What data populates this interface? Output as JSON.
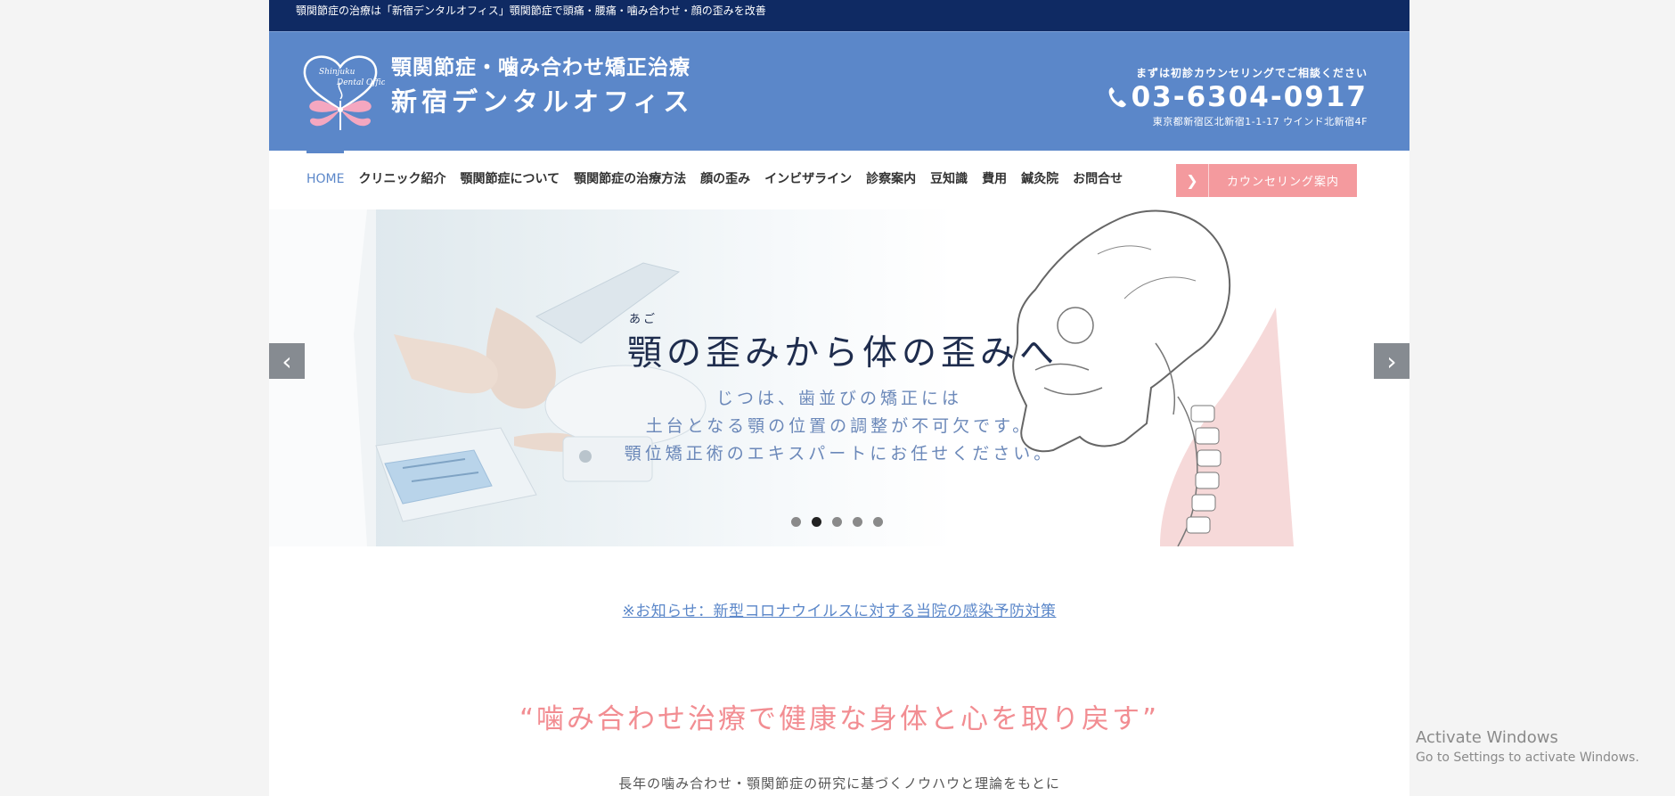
{
  "topbar": {
    "text": "顎関節症の治療は「新宿デンタルオフィス」顎関節症で頭痛・腰痛・噛み合わせ・顔の歪みを改善"
  },
  "header": {
    "logo_script": [
      "Shinjuku",
      "Dental Office"
    ],
    "title_line1": "顎関節症・噛み合わせ矯正治療",
    "title_line2": "新宿デンタルオフィス",
    "contact_lead": "まずは初診カウンセリングでご相談ください",
    "phone": "03-6304-0917",
    "address": "東京都新宿区北新宿1-1-17 ウインド北新宿4F"
  },
  "nav": {
    "items": [
      {
        "label": "HOME",
        "active": true
      },
      {
        "label": "クリニック紹介"
      },
      {
        "label": "顎関節症について"
      },
      {
        "label": "顎関節症の治療方法"
      },
      {
        "label": "顔の歪み"
      },
      {
        "label": "インビザライン"
      },
      {
        "label": "診察案内"
      },
      {
        "label": "豆知識"
      },
      {
        "label": "費用"
      },
      {
        "label": "鍼灸院"
      },
      {
        "label": "お問合せ"
      }
    ],
    "cta_label": "カウンセリング案内"
  },
  "slider": {
    "ruby": "あご",
    "title": "顎の歪みから体の歪みへ",
    "body": [
      "じつは、歯並びの矯正には",
      "土台となる顎の位置の調整が不可欠です。",
      "顎位矯正術のエキスパートにお任せください。"
    ],
    "dot_count": 5,
    "active_dot": 1
  },
  "content": {
    "notice_link": "※お知らせ：新型コロナウイルスに対する当院の感染予防対策",
    "headline": "“噛み合わせ治療で健康な身体と心を取り戻す”",
    "intro_line1": "長年の噛み合わせ・顎関節症の研究に基づくノウハウと理論をもとに"
  },
  "watermark": {
    "line1": "Activate Windows",
    "line2": "Go to Settings to activate Windows."
  },
  "colors": {
    "topbar": "#0f2a63",
    "header": "#5b87c9",
    "accent_pink": "#f49a9e",
    "headline_pink": "#f28d92",
    "link_blue": "#5b87c9"
  }
}
